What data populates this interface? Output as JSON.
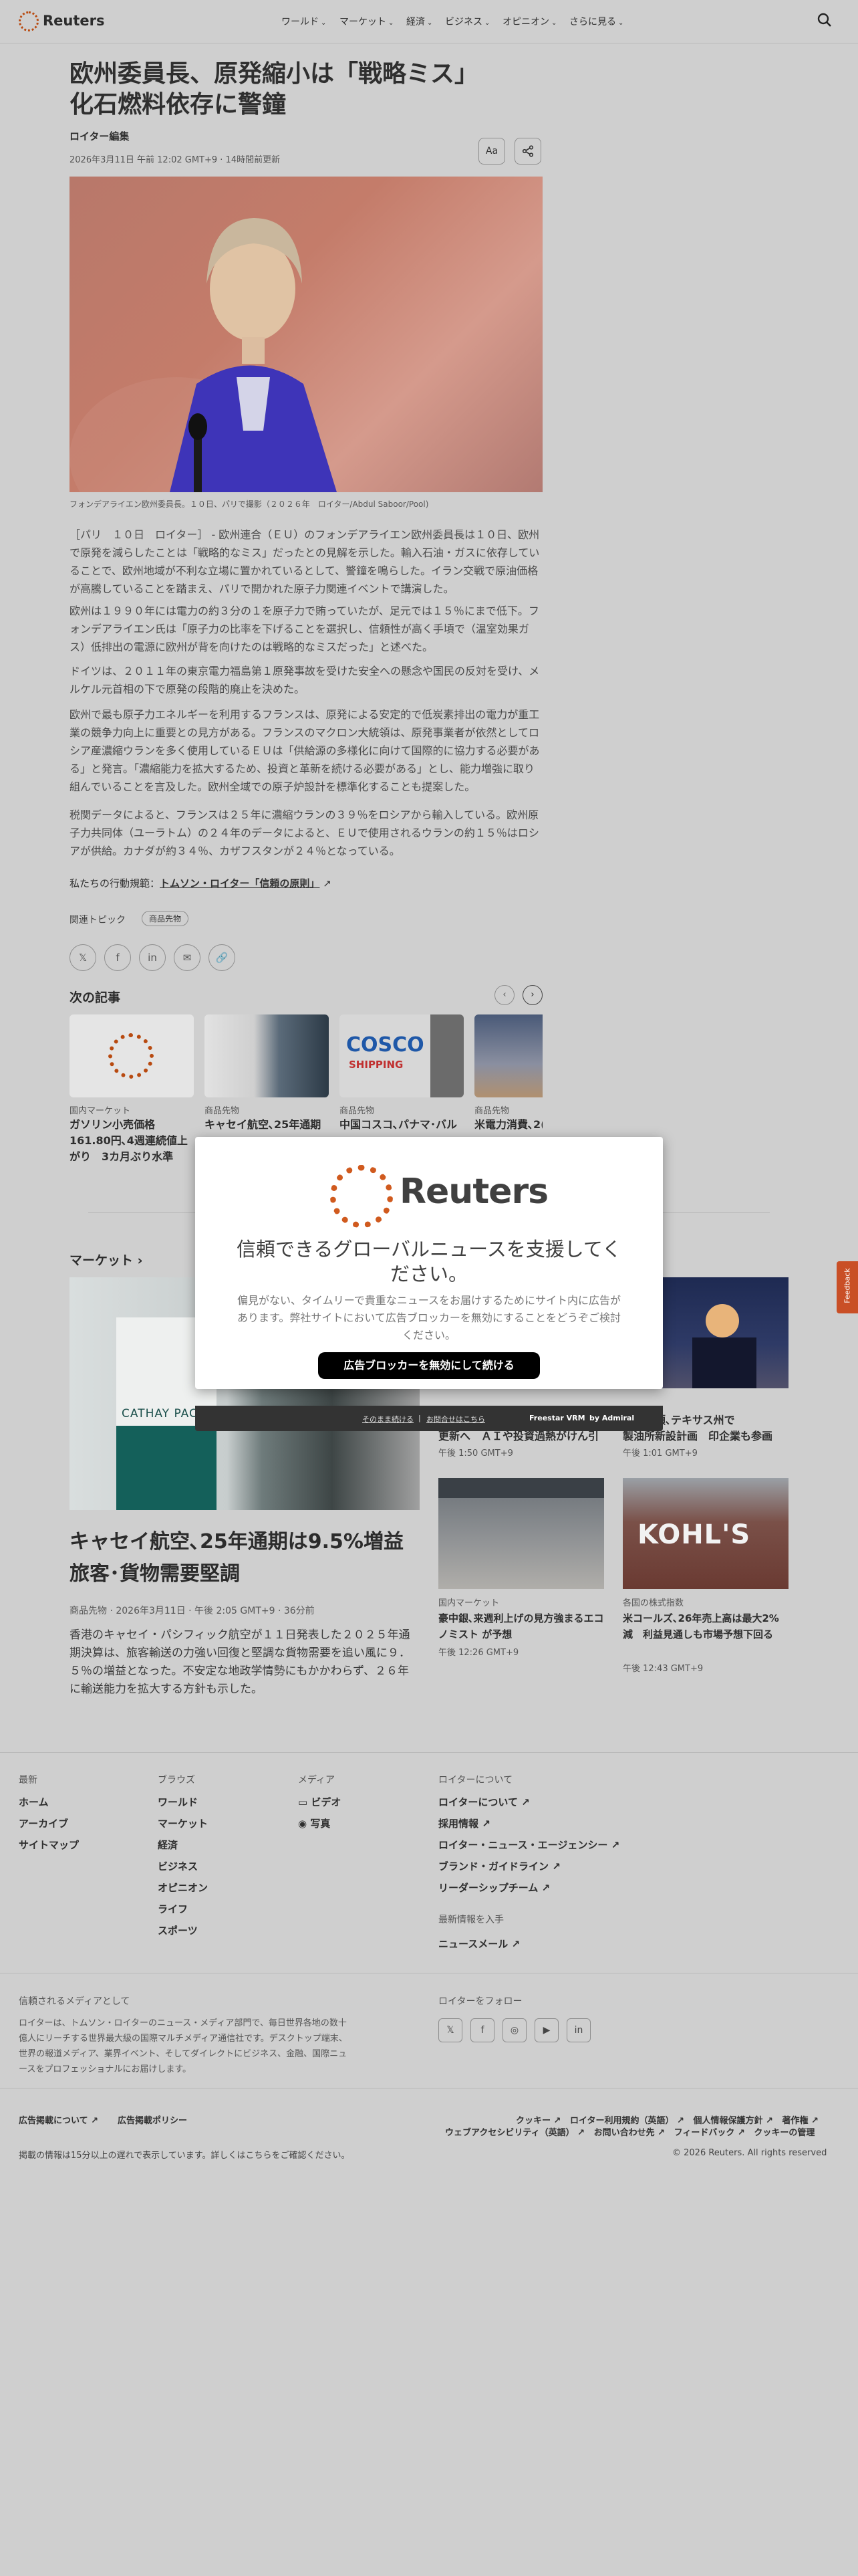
{
  "header": {
    "brand": "Reuters",
    "nav": [
      "ワールド",
      "マーケット",
      "経済",
      "ビジネス",
      "オピニオン",
      "さらに見る"
    ],
    "search_icon": "search-icon"
  },
  "article": {
    "title_line1": "欧州委員長、原発縮小は「戦略ミス」",
    "title_line2": "化石燃料依存に警鐘",
    "byline": "ロイター編集",
    "dateline": "2026年3月11日 午前 12:02 GMT+9 · 14時間前更新",
    "text_size_label": "Aa",
    "caption": "フォンデアライエン欧州委員長。１０日、パリで撮影（２０２６年　ロイター/Abdul Saboor/Pool)",
    "paragraphs": [
      "［パリ　１０日　ロイター］ - 欧州連合（ＥＵ）のフォンデアライエン欧州委員長は１０日、欧州で原発を減らしたことは「戦略的なミス」だったとの見解を示した。輸入石油・ガスに依存していることで、欧州地域が不利な立場に置かれているとして、警鐘を鳴らした。イラン交戦で原油価格が高騰していることを踏まえ、パリで開かれた原子力関連イベントで講演した。",
      "欧州は１９９０年には電力の約３分の１を原子力で賄っていたが、足元では１５％にまで低下。フォンデアライエン氏は「原子力の比率を下げることを選択し、信頼性が高く手頃で（温室効果ガス）低排出の電源に欧州が背を向けたのは戦略的なミスだった」と述べた。",
      "ドイツは、２０１１年の東京電力福島第１原発事故を受けた安全への懸念や国民の反対を受け、メルケル元首相の下で原発の段階的廃止を決めた。",
      "欧州で最も原子力エネルギーを利用するフランスは、原発による安定的で低炭素排出の電力が重工業の競争力向上に重要との見方がある。フランスのマクロン大統領は、原発事業者が依然としてロシア産濃縮ウランを多く使用しているＥＵは「供給源の多様化に向けて国際的に協力する必要がある」と発言。「濃縮能力を拡大するため、投資と革新を続ける必要がある」とし、能力増強に取り組んでいることを言及した。欧州全域での原子炉設計を標準化することも提案した。",
      "税関データによると、フランスは２５年に濃縮ウランの３９％をロシアから輸入している。欧州原子力共同体（ユーラトム）の２４年のデータによると、ＥＵで使用されるウランの約１５％はロシアが供給。カナダが約３４％、カザフスタンが２４％となっている。"
    ],
    "principles_prefix": "私たちの行動規範：",
    "principles_link": "トムソン・ロイター「信頼の原則」",
    "topics_label": "関連トピック",
    "topic_tag": "商品先物"
  },
  "share": [
    "x-icon",
    "facebook-icon",
    "linkedin-icon",
    "mail-icon",
    "link-icon"
  ],
  "next_articles": {
    "heading": "次の記事",
    "cards": [
      {
        "kicker": "国内マーケット",
        "title": "ガソリン小売価格161.80円､4週連続値上がり　3カ月ぶり水準"
      },
      {
        "kicker": "商品先物",
        "title": "キャセイ航空､25年通期"
      },
      {
        "kicker": "商品先物",
        "title": "中国コスコ､パナマ･バル"
      },
      {
        "kicker": "商品先物",
        "title": "米電力消費､2("
      }
    ]
  },
  "markets": {
    "heading": "マーケット",
    "main_title": "キャセイ航空､25年通期は9.5%増益　旅客･貨物需要堅調",
    "main_meta": "商品先物 · 2026年3月11日 · 午後 2:05 GMT+9 · 36分前",
    "main_summary": "香港のキャセイ・パシフィック航空が１１日発表した２０２５年通期決算は、旅客輸送の力強い回復と堅調な貨物需要を追い風に９．５％の増益となった。不安定な地政学情勢にもかかわらず、２６年に輸送能力を拡大する方針も示した。",
    "side": [
      {
        "kicker": "",
        "title": "更新へ　ＡＩや投資過熱がけん引",
        "time": "午後 1:50 GMT+9"
      },
      {
        "kicker": "",
        "title": "製油所新設計画　印企業も参画",
        "time": "午後 1:01 GMT+9"
      },
      {
        "kicker": "国内マーケット",
        "title": "豪中銀､来週利上げの見方強まるエコノミスト が予想",
        "time": "午後 12:26 GMT+9"
      },
      {
        "kicker": "各国の株式指数",
        "title": "米コールズ､26年売上高は最大2%減　利益見通しも市場予想下回る",
        "time": "午後 12:43 GMT+9"
      }
    ],
    "side_title_partial_1": "米大統領､テキサス州で"
  },
  "modal": {
    "brand": "Reuters",
    "headline": "信頼できるグローバルニュースを支援してください。",
    "body": "偏見がない、タイムリーで貴重なニュースをお届けするためにサイト内に広告があります。弊社サイトにおいて広告ブロッカーを無効にすることをどうぞご検討ください。",
    "cta": "広告ブロッカーを無効にして続ける",
    "continue_link": "そのまま続ける",
    "contact_link": "お問合せはこちら",
    "powered": "Freestar VRM",
    "admiral": "by Admiral"
  },
  "feedback": "Feedback",
  "footer": {
    "col1_head": "最新",
    "col1": [
      "ホーム",
      "アーカイブ",
      "サイトマップ"
    ],
    "col2_head": "ブラウズ",
    "col2": [
      "ワールド",
      "マーケット",
      "経済",
      "ビジネス",
      "オピニオン",
      "ライフ",
      "スポーツ"
    ],
    "col3_head": "メディア",
    "col3": [
      "ビデオ",
      "写真"
    ],
    "col4_head": "ロイターについて",
    "col4": [
      "ロイターについて",
      "採用情報",
      "ロイター・ニュース・エージェンシー",
      "ブランド・ガイドライン",
      "リーダーシップチーム"
    ],
    "col4b_head": "最新情報を入手",
    "col4b": [
      "ニュースメール"
    ],
    "trusted_head": "信頼されるメディアとして",
    "trusted_text": "ロイターは、トムソン・ロイターのニュース・メディア部門で、毎日世界各地の数十億人にリーチする世界最大級の国際マルチメディア通信社です。デスクトップ端末、世界の報道メディア、業界イベント、そしてダイレクトにビジネス、金融、国際ニュースをプロフェッショナルにお届けします。",
    "follow_head": "ロイターをフォロー",
    "ad_links": [
      "広告掲載について",
      "広告掲載ポリシー"
    ],
    "legal_row1": [
      "クッキー",
      "ロイター利用規約（英語）",
      "個人情報保護方針",
      "著作権"
    ],
    "legal_row2": [
      "ウェブアクセシビリティ（英語）",
      "お問い合わせ先",
      "フィードバック",
      "クッキーの管理"
    ],
    "delay_note": "掲載の情報は15分以上の遅れで表示しています。詳しくはこちらをご確認ください。",
    "copyright": "© 2026 Reuters. All rights reserved"
  }
}
